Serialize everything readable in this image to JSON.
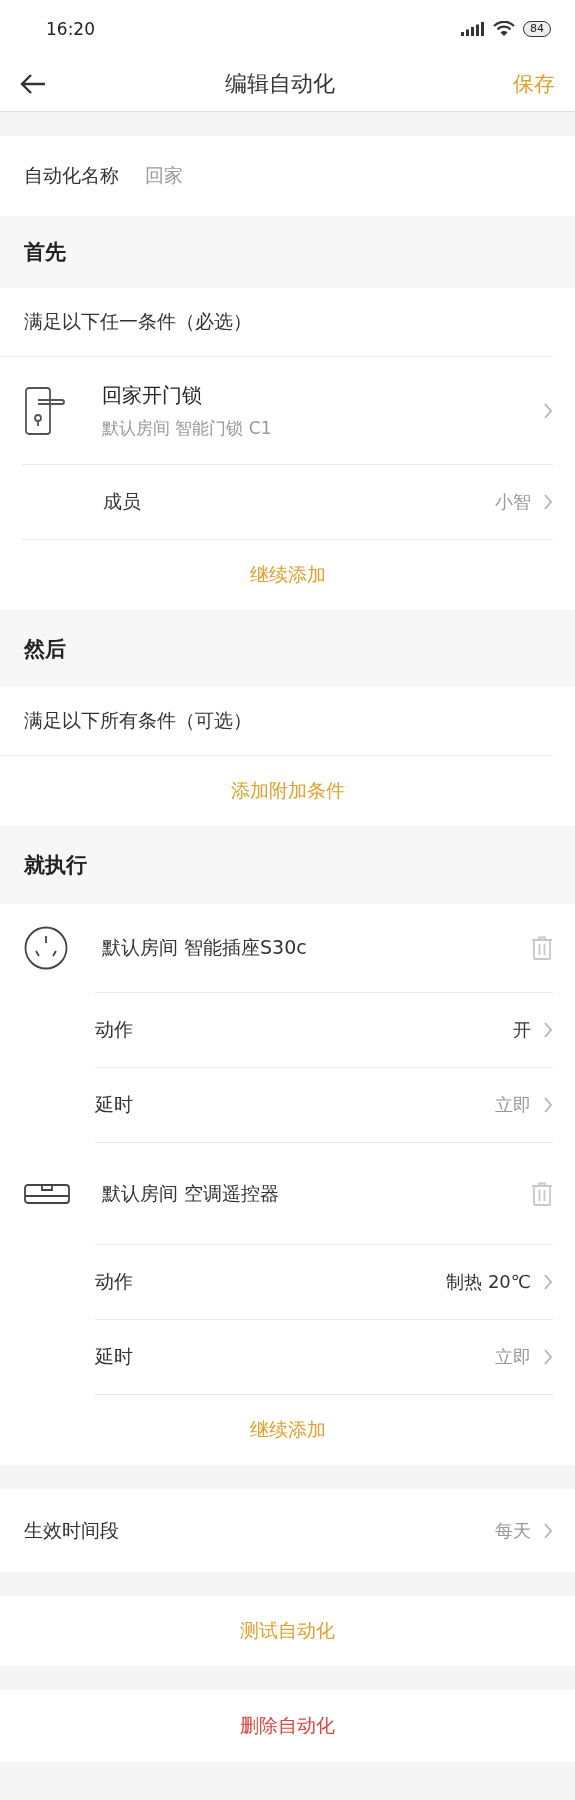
{
  "status_bar": {
    "time": "16:20",
    "battery": "84"
  },
  "nav": {
    "title": "编辑自动化",
    "action": "保存"
  },
  "name_field": {
    "label": "自动化名称",
    "value": "回家"
  },
  "conditions": {
    "title": "首先",
    "subtitle": "满足以下任一条件（必选）",
    "items": [
      {
        "kind": "lock",
        "title": "回家开门锁",
        "subtitle": "默认房间 智能门锁 C1"
      },
      {
        "kind": "setting",
        "label": "成员",
        "value": "小智"
      }
    ],
    "add_button": "继续添加"
  },
  "extra": {
    "title": "然后",
    "subtitle": "满足以下所有条件（可选）",
    "add_button": "添加附加条件"
  },
  "actions": {
    "title": "就执行",
    "devices": [
      {
        "kind": "socket",
        "name": "默认房间 智能插座S30c",
        "settings": [
          {
            "label": "动作",
            "value": "开"
          },
          {
            "label": "延时",
            "value": "立即"
          }
        ]
      },
      {
        "kind": "aircon",
        "name": "默认房间 空调遥控器",
        "settings": [
          {
            "label": "动作",
            "value": "制热 20℃"
          },
          {
            "label": "延时",
            "value": "立即"
          }
        ]
      }
    ],
    "add_button": "继续添加"
  },
  "schedule": {
    "label": "生效时间段",
    "value": "每天"
  },
  "test_button": "测试自动化",
  "delete_button": "删除自动化"
}
